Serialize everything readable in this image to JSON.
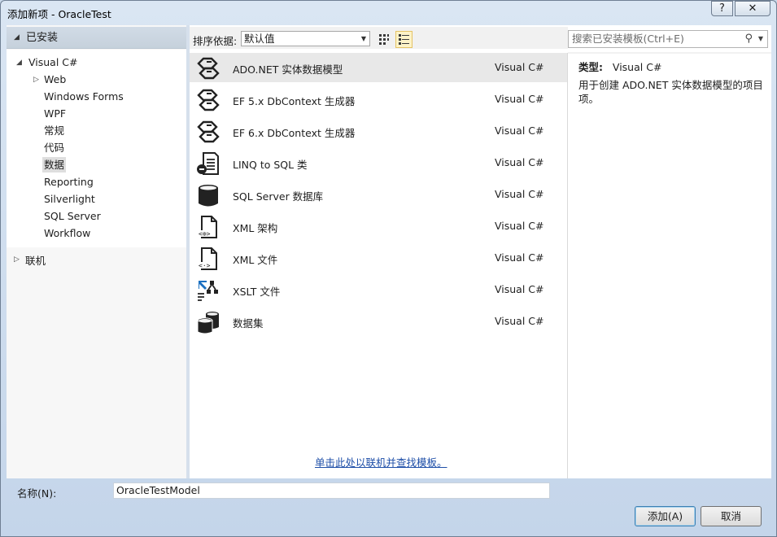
{
  "window": {
    "title": "添加新项 - OracleTest",
    "help_label": "?",
    "close_label": "✕"
  },
  "left": {
    "installed_label": "已安装",
    "tree": [
      {
        "label": "Visual C#"
      },
      {
        "label": "Web"
      },
      {
        "label": "Windows Forms"
      },
      {
        "label": "WPF"
      },
      {
        "label": "常规"
      },
      {
        "label": "代码"
      },
      {
        "label": "数据",
        "selected": true
      },
      {
        "label": "Reporting"
      },
      {
        "label": "Silverlight"
      },
      {
        "label": "SQL Server"
      },
      {
        "label": "Workflow"
      }
    ],
    "online_label": "联机"
  },
  "toolbar": {
    "sort_label": "排序依据:",
    "sort_value": "默认值"
  },
  "items": [
    {
      "name": "ADO.NET 实体数据模型",
      "lang": "Visual C#",
      "icon": "entity-model-icon",
      "selected": true
    },
    {
      "name": "EF 5.x DbContext 生成器",
      "lang": "Visual C#",
      "icon": "dbcontext-generator-icon"
    },
    {
      "name": "EF 6.x DbContext 生成器",
      "lang": "Visual C#",
      "icon": "dbcontext-generator-icon"
    },
    {
      "name": "LINQ to SQL 类",
      "lang": "Visual C#",
      "icon": "linq-to-sql-icon"
    },
    {
      "name": "SQL Server 数据库",
      "lang": "Visual C#",
      "icon": "database-icon"
    },
    {
      "name": "XML 架构",
      "lang": "Visual C#",
      "icon": "xml-schema-icon"
    },
    {
      "name": "XML 文件",
      "lang": "Visual C#",
      "icon": "xml-file-icon"
    },
    {
      "name": "XSLT 文件",
      "lang": "Visual C#",
      "icon": "xslt-icon"
    },
    {
      "name": "数据集",
      "lang": "Visual C#",
      "icon": "dataset-icon"
    }
  ],
  "online_link": "单击此处以联机并查找模板。",
  "right": {
    "search_placeholder": "搜索已安装模板(Ctrl+E)",
    "type_label": "类型:",
    "type_value": "Visual C#",
    "description": "用于创建 ADO.NET 实体数据模型的项目项。"
  },
  "bottom": {
    "name_label": "名称(N):",
    "name_value": "OracleTestModel",
    "add_label": "添加(A)",
    "cancel_label": "取消"
  }
}
